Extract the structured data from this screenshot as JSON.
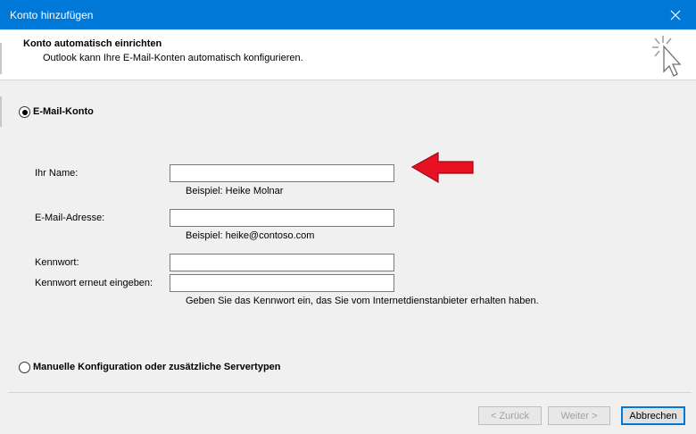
{
  "window": {
    "title": "Konto hinzufügen"
  },
  "header": {
    "heading": "Konto automatisch einrichten",
    "subheading": "Outlook kann Ihre E-Mail-Konten automatisch konfigurieren."
  },
  "email_account": {
    "label": "E-Mail-Konto",
    "selected": true,
    "fields": {
      "name": {
        "label": "Ihr Name:",
        "value": "",
        "hint": "Beispiel: Heike Molnar"
      },
      "email": {
        "label": "E-Mail-Adresse:",
        "value": "",
        "hint": "Beispiel: heike@contoso.com"
      },
      "password": {
        "label": "Kennwort:",
        "value": ""
      },
      "password_repeat": {
        "label": "Kennwort erneut eingeben:",
        "value": ""
      }
    },
    "password_hint": "Geben Sie das Kennwort ein, das Sie vom Internetdienstanbieter erhalten haben."
  },
  "manual_config": {
    "label": "Manuelle Konfiguration oder zusätzliche Servertypen",
    "selected": false
  },
  "buttons": {
    "back": "< Zurück",
    "next": "Weiter >",
    "cancel": "Abbrechen"
  },
  "colors": {
    "titlebar": "#0078d7",
    "annotation_arrow": "#e81123"
  },
  "icons": {
    "close": "close-icon",
    "wizard": "wizard-cursor-icon",
    "annotation": "red-arrow-icon"
  }
}
